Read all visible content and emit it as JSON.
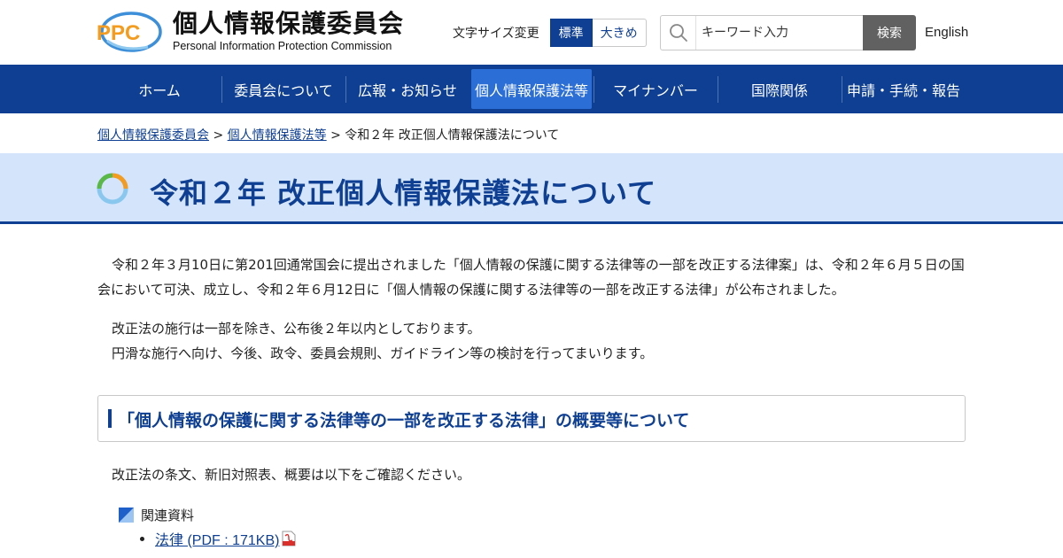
{
  "header": {
    "logo_mark": "PPC",
    "logo_ja": "個人情報保護委員会",
    "logo_en": "Personal Information Protection Commission",
    "fontsize_label": "文字サイズ変更",
    "fontsize_standard": "標準",
    "fontsize_large": "大きめ",
    "search_placeholder": "キーワード入力",
    "search_button": "検索",
    "language": "English"
  },
  "nav": {
    "items": [
      {
        "label": "ホーム"
      },
      {
        "label": "委員会について"
      },
      {
        "label": "広報・お知らせ"
      },
      {
        "label": "個人情報保護法等",
        "active": true
      },
      {
        "label": "マイナンバー"
      },
      {
        "label": "国際関係"
      },
      {
        "label": "申請・手続・報告"
      }
    ]
  },
  "breadcrumb": {
    "items": [
      "個人情報保護委員会",
      "個人情報保護法等"
    ],
    "separator": ">",
    "current": "令和２年 改正個人情報保護法について"
  },
  "page": {
    "title": "令和２年 改正個人情報保護法について",
    "intro": "令和２年３月10日に第201回通常国会に提出されました「個人情報の保護に関する法律等の一部を改正する法律案」は、令和２年６月５日の国会において可決、成立し、令和２年６月12日に「個人情報の保護に関する法律等の一部を改正する法律」が公布されました。",
    "note1": "改正法の施行は一部を除き、公布後２年以内としております。",
    "note2": "円滑な施行へ向け、今後、政令、委員会規則、ガイドライン等の検討を行ってまいります。",
    "section_title": "「個人情報の保護に関する法律等の一部を改正する法律」の概要等について",
    "section_text": "改正法の条文、新旧対照表、概要は以下をご確認ください。",
    "related_label": "関連資料",
    "documents": [
      {
        "label": "法律 (PDF : 171KB)"
      }
    ]
  },
  "colors": {
    "brand_navy": "#0e3f92",
    "nav_active": "#2b6fd6",
    "title_band": "#d4e4fa",
    "search_button": "#616161"
  }
}
